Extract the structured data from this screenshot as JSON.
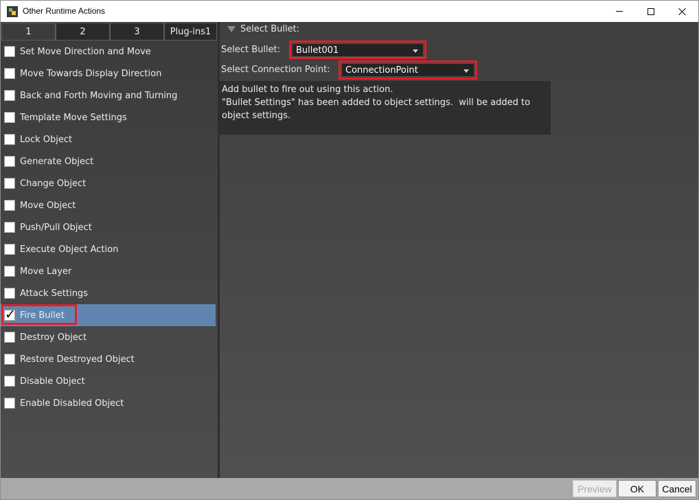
{
  "window": {
    "title": "Other Runtime Actions"
  },
  "tabs": [
    {
      "label": "1"
    },
    {
      "label": "2"
    },
    {
      "label": "3"
    },
    {
      "label": "Plug-ins1"
    }
  ],
  "actions": [
    {
      "label": "Set Move Direction and Move",
      "checked": false
    },
    {
      "label": "Move Towards Display Direction",
      "checked": false
    },
    {
      "label": "Back and Forth Moving and Turning",
      "checked": false
    },
    {
      "label": "Template Move Settings",
      "checked": false
    },
    {
      "label": "Lock Object",
      "checked": false
    },
    {
      "label": "Generate Object",
      "checked": false
    },
    {
      "label": "Change Object",
      "checked": false
    },
    {
      "label": "Move Object",
      "checked": false
    },
    {
      "label": "Push/Pull Object",
      "checked": false
    },
    {
      "label": "Execute Object Action",
      "checked": false
    },
    {
      "label": "Move Layer",
      "checked": false
    },
    {
      "label": "Attack Settings",
      "checked": false
    },
    {
      "label": "Fire Bullet",
      "checked": true
    },
    {
      "label": "Destroy Object",
      "checked": false
    },
    {
      "label": "Restore Destroyed Object",
      "checked": false
    },
    {
      "label": "Disable Object",
      "checked": false
    },
    {
      "label": "Enable Disabled Object",
      "checked": false
    }
  ],
  "details": {
    "section_title": "Select Bullet:",
    "bullet_label": "Select Bullet:",
    "bullet_value": "Bullet001",
    "connection_label": "Select Connection Point:",
    "connection_value": "ConnectionPoint",
    "description": "Add bullet to fire out using this action.\n\"Bullet Settings\" has been added to object settings.  will be added to\nobject settings."
  },
  "buttons": {
    "preview": "Preview",
    "ok": "OK",
    "cancel": "Cancel"
  },
  "colors": {
    "selection": "#5f86b0",
    "highlight": "#e0202a"
  }
}
